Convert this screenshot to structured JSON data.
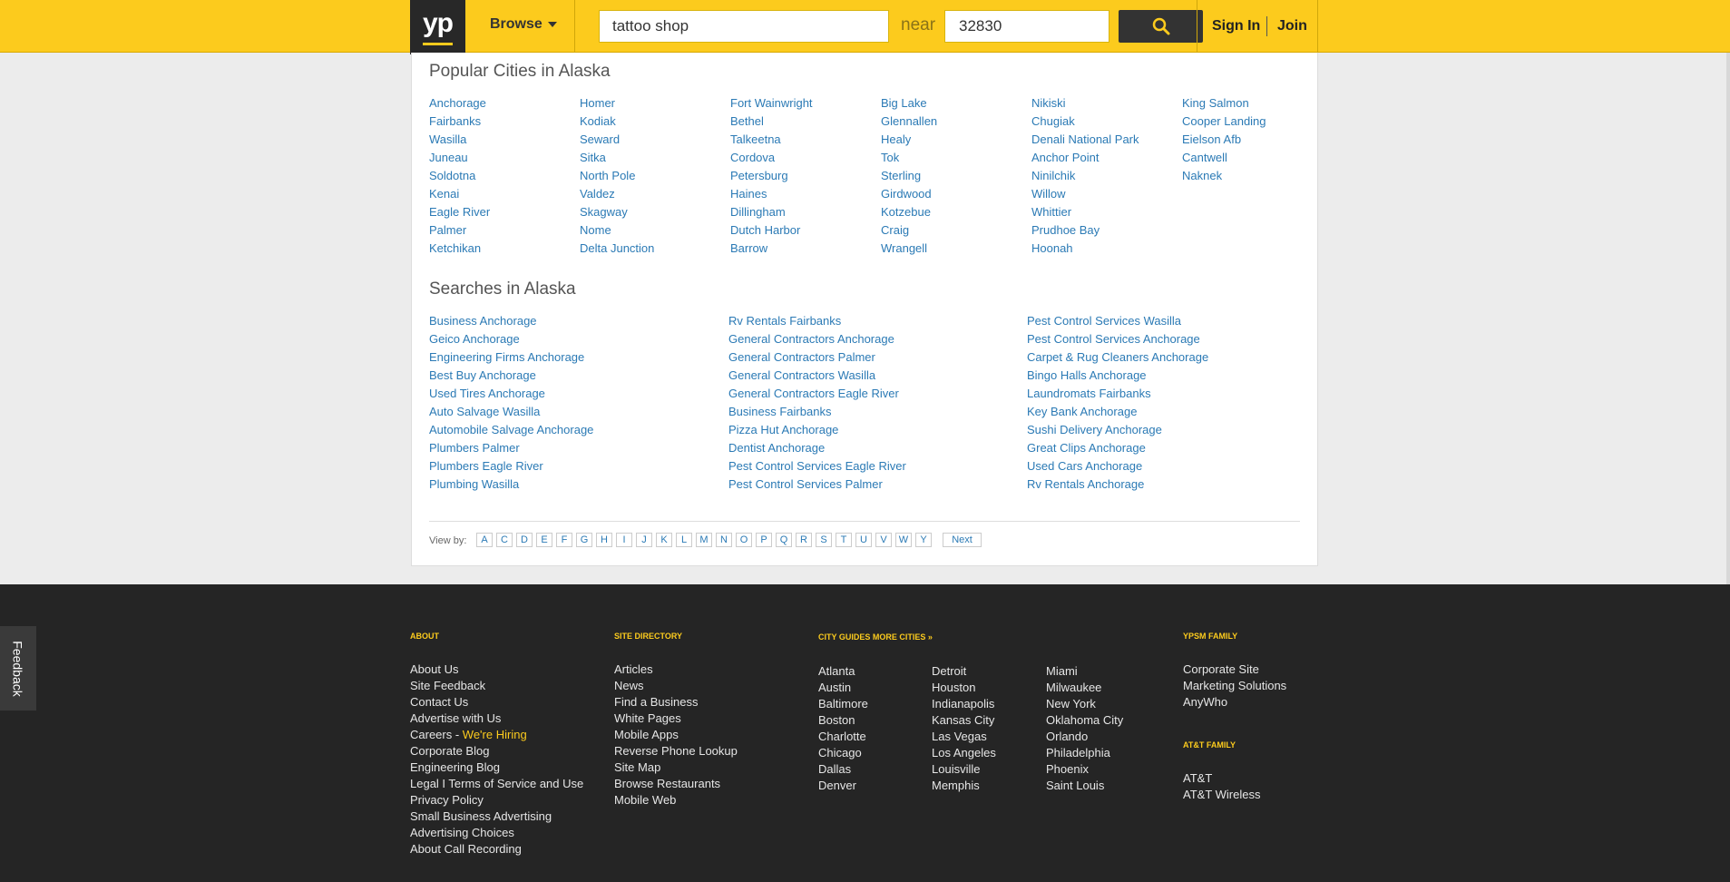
{
  "header": {
    "logo": "yp",
    "browse_label": "Browse",
    "search_value": "tattoo shop",
    "near_label": "near",
    "location_value": "32830",
    "signin_label": "Sign In",
    "join_label": "Join"
  },
  "popular": {
    "title": "Popular Cities in Alaska",
    "columns": [
      [
        "Anchorage",
        "Fairbanks",
        "Wasilla",
        "Juneau",
        "Soldotna",
        "Kenai",
        "Eagle River",
        "Palmer",
        "Ketchikan"
      ],
      [
        "Homer",
        "Kodiak",
        "Seward",
        "Sitka",
        "North Pole",
        "Valdez",
        "Skagway",
        "Nome",
        "Delta Junction"
      ],
      [
        "Fort Wainwright",
        "Bethel",
        "Talkeetna",
        "Cordova",
        "Petersburg",
        "Haines",
        "Dillingham",
        "Dutch Harbor",
        "Barrow"
      ],
      [
        "Big Lake",
        "Glennallen",
        "Healy",
        "Tok",
        "Sterling",
        "Girdwood",
        "Kotzebue",
        "Craig",
        "Wrangell"
      ],
      [
        "Nikiski",
        "Chugiak",
        "Denali National Park",
        "Anchor Point",
        "Ninilchik",
        "Willow",
        "Whittier",
        "Prudhoe Bay",
        "Hoonah"
      ],
      [
        "King Salmon",
        "Cooper Landing",
        "Eielson Afb",
        "Cantwell",
        "Naknek"
      ]
    ]
  },
  "searches": {
    "title": "Searches in Alaska",
    "columns": [
      [
        "Business Anchorage",
        "Geico Anchorage",
        "Engineering Firms Anchorage",
        "Best Buy Anchorage",
        "Used Tires Anchorage",
        "Auto Salvage Wasilla",
        "Automobile Salvage Anchorage",
        "Plumbers Palmer",
        "Plumbers Eagle River",
        "Plumbing Wasilla"
      ],
      [
        "Rv Rentals Fairbanks",
        "General Contractors Anchorage",
        "General Contractors Palmer",
        "General Contractors Wasilla",
        "General Contractors Eagle River",
        "Business Fairbanks",
        "Pizza Hut Anchorage",
        "Dentist Anchorage",
        "Pest Control Services Eagle River",
        "Pest Control Services Palmer"
      ],
      [
        "Pest Control Services Wasilla",
        "Pest Control Services Anchorage",
        "Carpet & Rug Cleaners Anchorage",
        "Bingo Halls Anchorage",
        "Laundromats Fairbanks",
        "Key Bank Anchorage",
        "Sushi Delivery Anchorage",
        "Great Clips Anchorage",
        "Used Cars Anchorage",
        "Rv Rentals Anchorage"
      ]
    ]
  },
  "pagination": {
    "view_by_label": "View by:",
    "letters": [
      "A",
      "C",
      "D",
      "E",
      "F",
      "G",
      "H",
      "I",
      "J",
      "K",
      "L",
      "M",
      "N",
      "O",
      "P",
      "Q",
      "R",
      "S",
      "T",
      "U",
      "V",
      "W",
      "Y"
    ],
    "next_label": "Next"
  },
  "footer": {
    "about": {
      "heading": "ABOUT",
      "links": [
        "About Us",
        "Site Feedback",
        "Contact Us",
        "Advertise with Us",
        "Careers - ",
        "Corporate Blog",
        "Engineering Blog",
        "Legal I Terms of Service and Use",
        "Privacy Policy",
        "Small Business Advertising",
        "Advertising Choices",
        "About Call Recording"
      ],
      "hiring_label": "We're Hiring"
    },
    "site_directory": {
      "heading": "SITE DIRECTORY",
      "links": [
        "Articles",
        "News",
        "Find a Business",
        "White Pages",
        "Mobile Apps",
        "Reverse Phone Lookup",
        "Site Map",
        "Browse Restaurants",
        "Mobile Web"
      ]
    },
    "city_guides": {
      "heading": "CITY GUIDES More Cities »",
      "columns": [
        [
          "Atlanta",
          "Austin",
          "Baltimore",
          "Boston",
          "Charlotte",
          "Chicago",
          "Dallas",
          "Denver"
        ],
        [
          "Detroit",
          "Houston",
          "Indianapolis",
          "Kansas City",
          "Las Vegas",
          "Los Angeles",
          "Louisville",
          "Memphis"
        ],
        [
          "Miami",
          "Milwaukee",
          "New York",
          "Oklahoma City",
          "Orlando",
          "Philadelphia",
          "Phoenix",
          "Saint Louis"
        ]
      ]
    },
    "yp_family": {
      "heading": "YPSM FAMILY",
      "links": [
        "Corporate Site",
        "Marketing Solutions",
        "AnyWho"
      ]
    },
    "att_family": {
      "heading": "AT&T FAMILY",
      "links": [
        "AT&T",
        "AT&T Wireless"
      ]
    }
  },
  "feedback_label": "Feedback",
  "colors": {
    "brand_yellow": "#fccb1d",
    "link_blue": "#2b7ab5",
    "footer_bg": "#252525"
  }
}
